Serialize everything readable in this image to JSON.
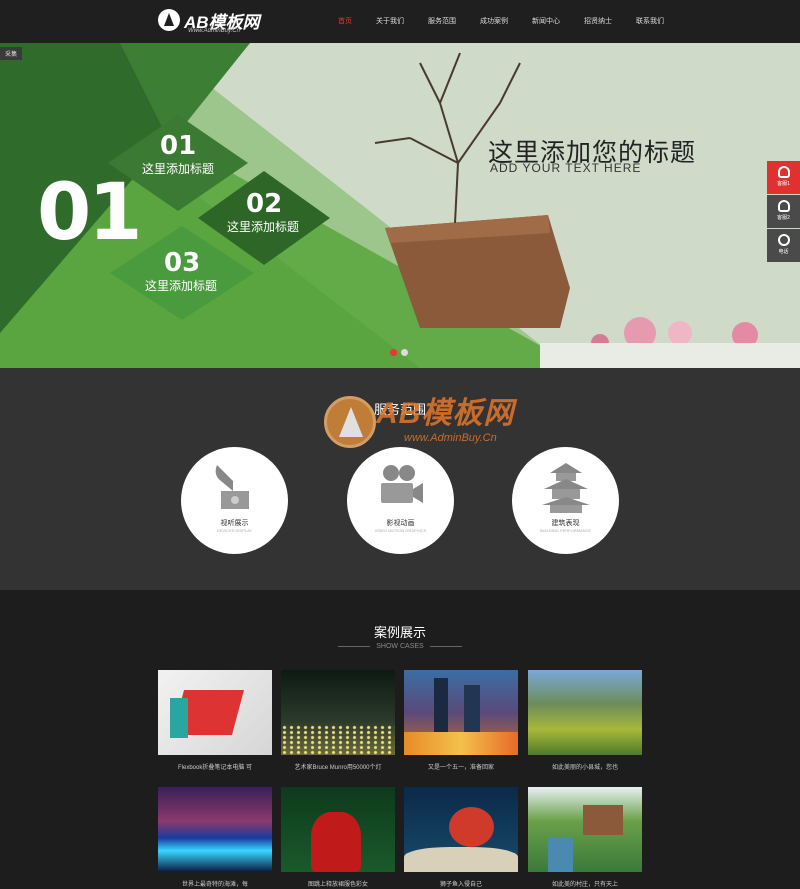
{
  "header": {
    "logo_title": "AB模板网",
    "logo_sub": "Www.AdminBuy.Cn",
    "nav": [
      {
        "label": "首页",
        "active": true
      },
      {
        "label": "关于我们"
      },
      {
        "label": "服务范围"
      },
      {
        "label": "成功案例"
      },
      {
        "label": "新闻中心"
      },
      {
        "label": "招贤纳士"
      },
      {
        "label": "联系我们"
      }
    ]
  },
  "banner": {
    "tag": "采集",
    "big_number": "01",
    "diamonds": [
      {
        "num": "01",
        "text": "这里添加标题"
      },
      {
        "num": "02",
        "text": "这里添加标题"
      },
      {
        "num": "03",
        "text": "这里添加标题"
      }
    ],
    "title": "这里添加您的标题",
    "subtitle": "ADD YOUR TEXT  HERE"
  },
  "side_buttons": [
    {
      "label": "客服1",
      "color": "#e03030"
    },
    {
      "label": "客服2",
      "color": "#4a4a4a"
    },
    {
      "label": "电话",
      "color": "#4a4a4a"
    }
  ],
  "services": {
    "title": "服务范围",
    "items": [
      {
        "label": "视听展示",
        "sub": "DEVICES DISPLAY",
        "icon": "gramophone-icon"
      },
      {
        "label": "影视动画",
        "sub": "VIDEO MOTION GRAPHICS",
        "icon": "film-camera-icon"
      },
      {
        "label": "建筑表现",
        "sub": "BUILDING PERFORMANCE",
        "icon": "pagoda-icon"
      }
    ]
  },
  "watermark": {
    "title": "AB模板网",
    "url": "www.AdminBuy.Cn"
  },
  "cases": {
    "title": "案例展示",
    "subtitle": "SHOW CASES",
    "items": [
      {
        "caption": "Flexbook折叠笔记本电脑 可"
      },
      {
        "caption": "艺术家Bruce Munro用50000个灯"
      },
      {
        "caption": "又是一个五一，准备回家"
      },
      {
        "caption": "如此美丽的小县城，您也"
      },
      {
        "caption": "世界上最奇特的海滩，每"
      },
      {
        "caption": "图跳上释放裙服色彩女"
      },
      {
        "caption": "狮子鱼入侵自己"
      },
      {
        "caption": "如此美的村庄，只有天上"
      }
    ]
  },
  "colors": {
    "accent": "#e33333",
    "banner_green": "#2f6b2a",
    "bright_green": "#5aa540"
  }
}
